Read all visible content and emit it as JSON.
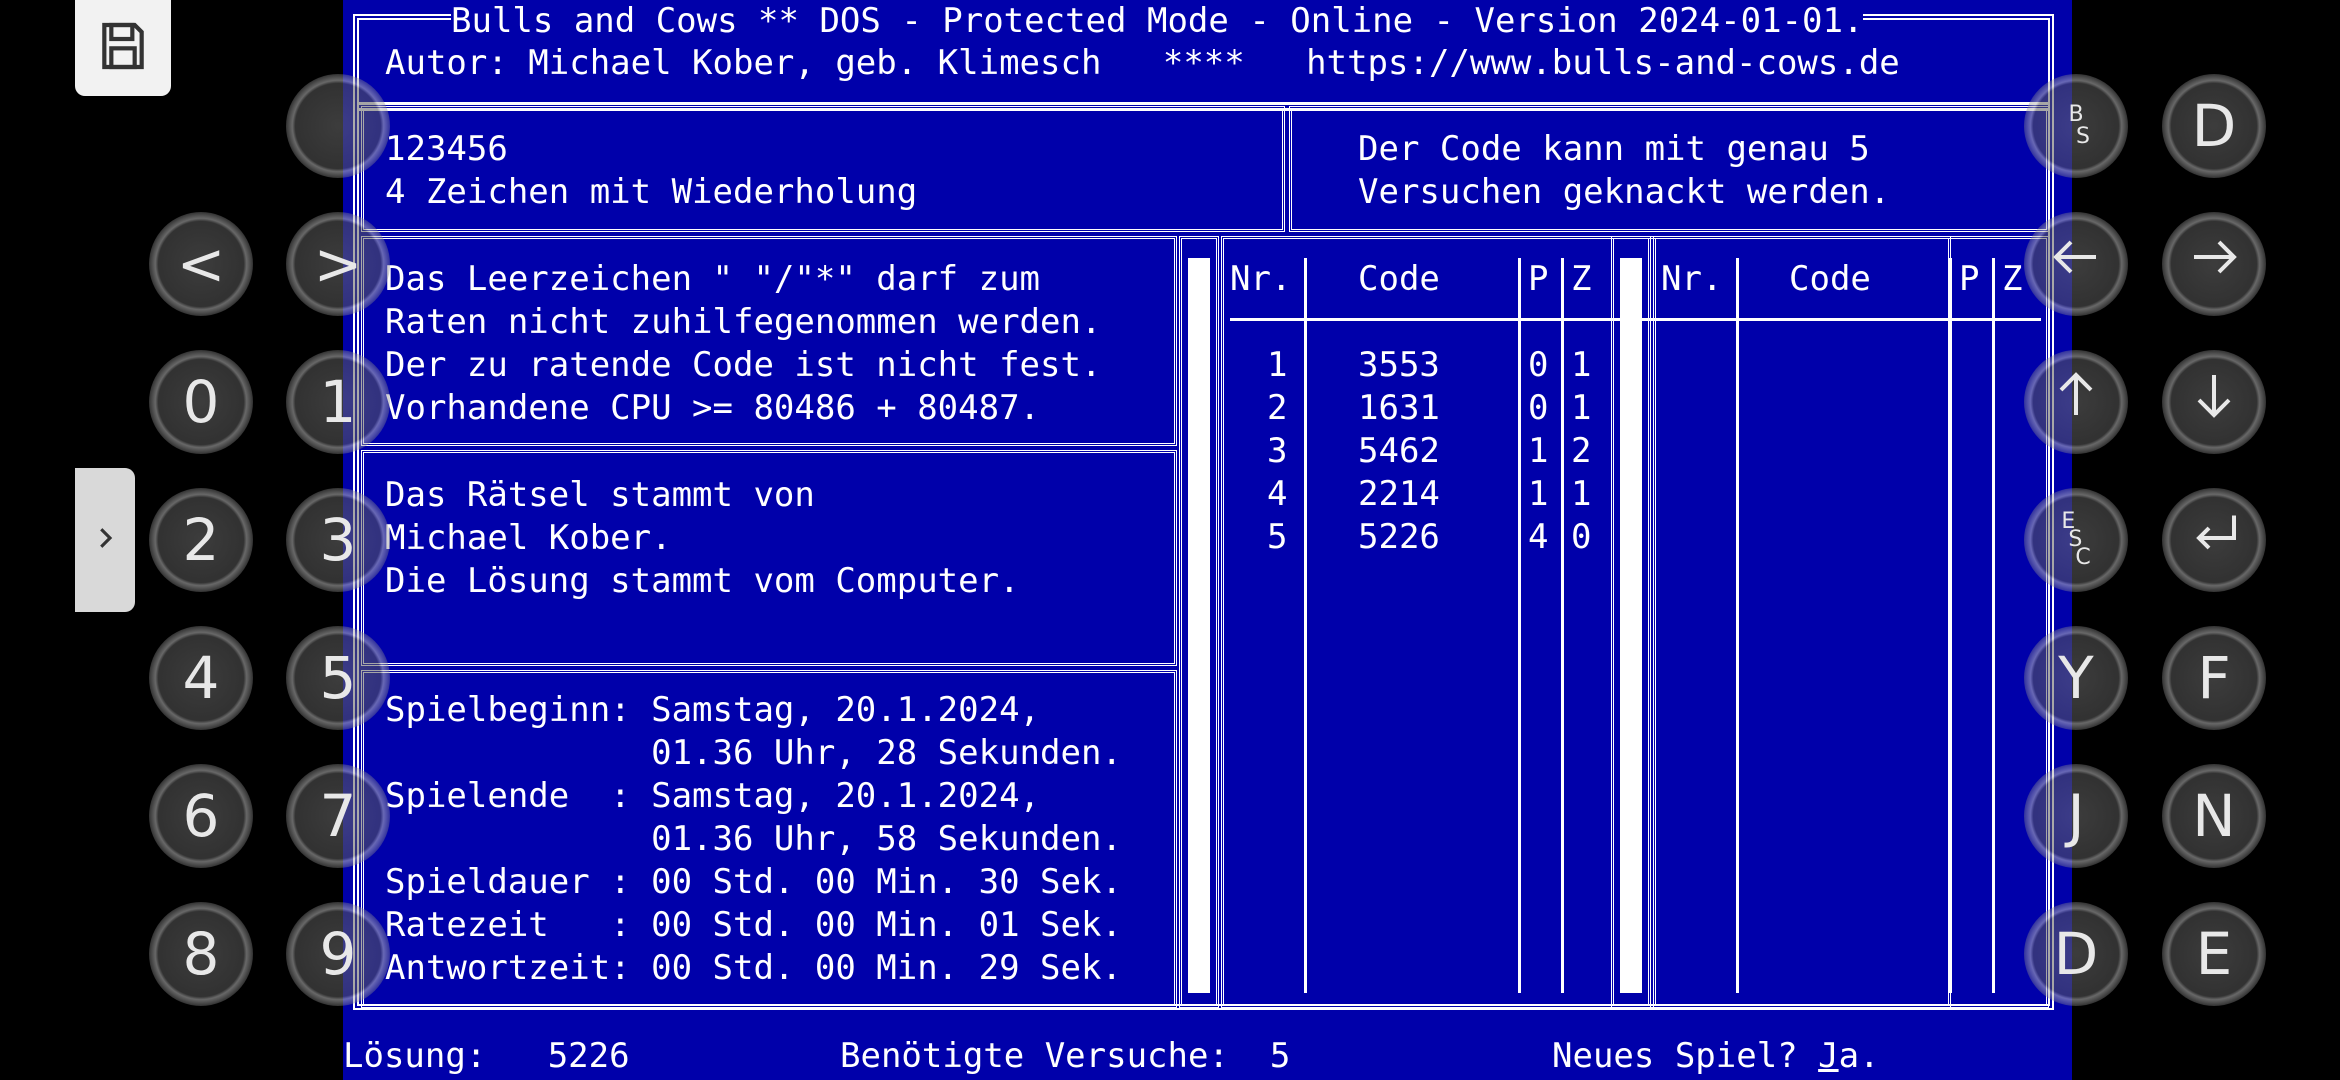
{
  "header": {
    "title": "Bulls and Cows ** DOS - Protected Mode - Online - Version 2024-01-01.",
    "author_line": "Autor: Michael Kober, geb. Klimesch   ****   https://www.bulls-and-cows.de"
  },
  "info_left": {
    "line1": "123456",
    "line2": "4 Zeichen mit Wiederholung"
  },
  "info_right": {
    "line1": "Der Code kann mit genau 5",
    "line2": "Versuchen geknackt werden."
  },
  "rules": {
    "line1": "Das Leerzeichen \" \"/\"*\" darf zum",
    "line2": "Raten nicht zuhilfegenommen werden.",
    "line3": "Der zu ratende Code ist nicht fest.",
    "line4": "Vorhandene CPU >= 80486 + 80487."
  },
  "credits": {
    "line1": "Das Rätsel stammt von",
    "line2": "Michael Kober.",
    "line3": "Die Lösung stammt vom Computer."
  },
  "timing": {
    "line1": "Spielbeginn: Samstag, 20.1.2024,",
    "line2": "             01.36 Uhr, 28 Sekunden.",
    "line3": "Spielende  : Samstag, 20.1.2024,",
    "line4": "             01.36 Uhr, 58 Sekunden.",
    "line5": "Spieldauer : 00 Std. 00 Min. 30 Sek.",
    "line6": "Ratezeit   : 00 Std. 00 Min. 01 Sek.",
    "line7": "Antwortzeit: 00 Std. 00 Min. 29 Sek."
  },
  "table1": {
    "headers": {
      "nr": "Nr.",
      "code": "Code",
      "p": "P",
      "z": "Z"
    },
    "rows": [
      {
        "nr": "1",
        "code": "3553",
        "p": "0",
        "z": "1"
      },
      {
        "nr": "2",
        "code": "1631",
        "p": "0",
        "z": "1"
      },
      {
        "nr": "3",
        "code": "5462",
        "p": "1",
        "z": "2"
      },
      {
        "nr": "4",
        "code": "2214",
        "p": "1",
        "z": "1"
      },
      {
        "nr": "5",
        "code": "5226",
        "p": "4",
        "z": "0"
      }
    ]
  },
  "table2": {
    "headers": {
      "nr": "Nr.",
      "code": "Code",
      "p": "P",
      "z": "Z"
    }
  },
  "status": {
    "solution": "Lösung:   5226",
    "attempts": "Benötigte Versuche:  5",
    "new_game_prefix": "Neues Spiel? ",
    "new_game_j": "J",
    "new_game_suffix": "a."
  },
  "keys_left": {
    "blank": "",
    "lt": "<",
    "gt": ">",
    "k0": "0",
    "k1": "1",
    "k2": "2",
    "k3": "3",
    "k4": "4",
    "k5": "5",
    "k6": "6",
    "k7": "7",
    "k8": "8",
    "k9": "9"
  },
  "keys_right": {
    "bs_top": "B",
    "bs_bottom": "S",
    "d1": "D",
    "esc_e": "E",
    "esc_s": "S",
    "esc_c": "C",
    "y": "Y",
    "f": "F",
    "j": "J",
    "n": "N",
    "d2": "D",
    "e": "E"
  },
  "icons": {
    "save": "floppy-disk-icon",
    "drawer": "chevron-right-icon",
    "left_arrow": "arrow-left-icon",
    "right_arrow": "arrow-right-icon",
    "up_arrow": "arrow-up-icon",
    "down_arrow": "arrow-down-icon",
    "enter": "enter-icon"
  },
  "colors": {
    "dos_blue": "#0000aa",
    "dos_white": "#ffffff"
  }
}
